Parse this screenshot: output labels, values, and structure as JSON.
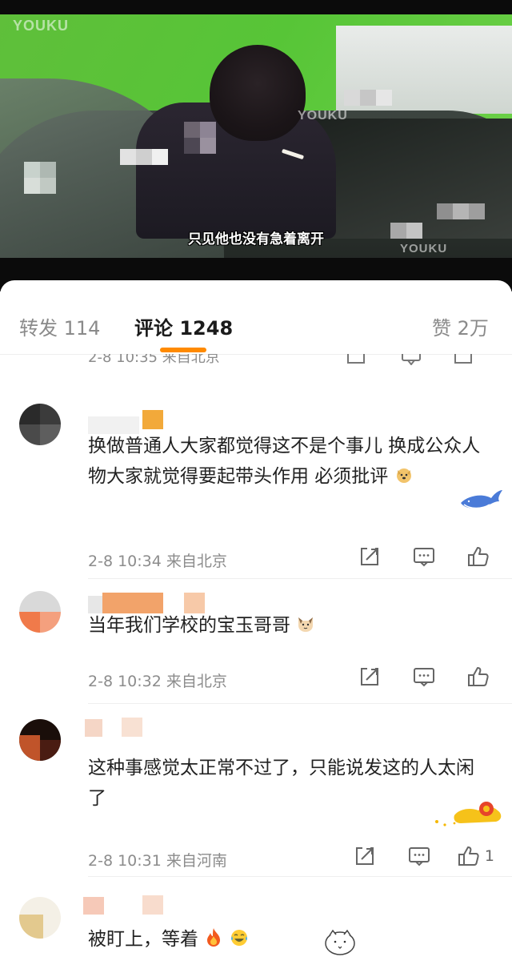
{
  "video": {
    "subtitle": "只见他也没有急着离开",
    "watermark": "YOUKU"
  },
  "tabs": [
    {
      "label": "转发",
      "count": "114"
    },
    {
      "label": "评论",
      "count": "1248",
      "active": true
    },
    {
      "label": "赞",
      "count": "2万"
    }
  ],
  "colors": {
    "accent": "#ff8a00",
    "meta": "#8c8c8c"
  },
  "cut_comment": {
    "time": "2-8 10:35",
    "location": "来自北京"
  },
  "comments": [
    {
      "text": "换做普通人大家都觉得这不是个事儿 换成公众人物大家就觉得要起带头作用 必须批评",
      "emoji": "dog-face-emoji",
      "time": "2-8 10:34",
      "location": "来自北京",
      "likes": ""
    },
    {
      "text": "当年我们学校的宝玉哥哥",
      "emoji": "cat-face-emoji",
      "time": "2-8 10:32",
      "location": "来自北京",
      "likes": ""
    },
    {
      "text": "这种事感觉太正常不过了，只能说发这的人太闲了",
      "time": "2-8 10:31",
      "location": "来自河南",
      "likes": "1"
    },
    {
      "text": "被盯上，等着",
      "emoji": "fire-and-tears-of-joy-emoji"
    }
  ]
}
